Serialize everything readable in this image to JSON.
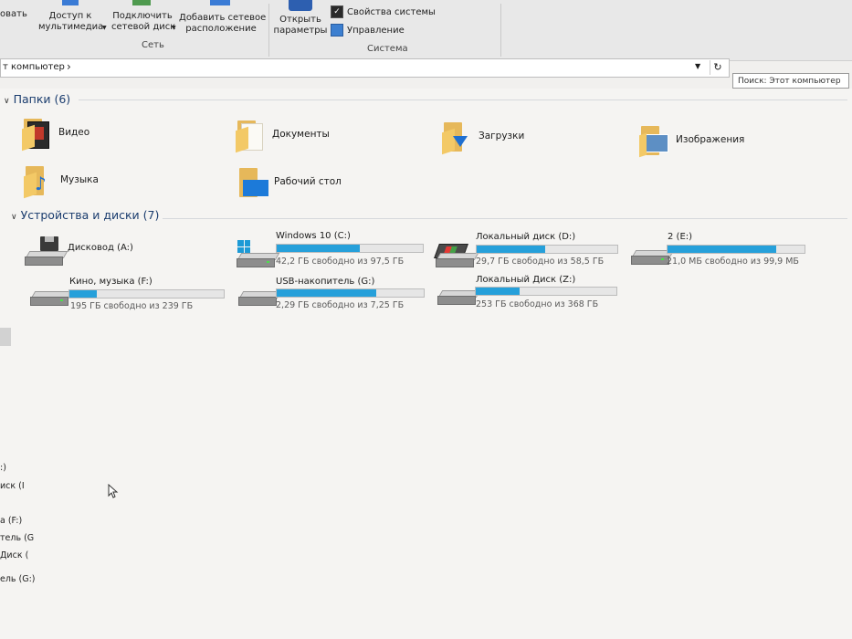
{
  "ribbon": {
    "partial_left": "овать",
    "media_access": "Доступ к\nмультимедиа",
    "map_drive": "Подключить\nсетевой диск",
    "add_location": "Добавить сетевое\nрасположение",
    "group_network": "Сеть",
    "open_settings": "Открыть\nпараметры",
    "system_properties": "Свойства системы",
    "manage": "Управление",
    "group_system": "Система"
  },
  "address": {
    "path": "т компьютер",
    "search_placeholder": "Поиск: Этот компьютер"
  },
  "folders": {
    "header": "Папки (6)",
    "items": [
      {
        "label": "Видео",
        "icon": "video-folder-icon"
      },
      {
        "label": "Документы",
        "icon": "documents-folder-icon"
      },
      {
        "label": "Загрузки",
        "icon": "downloads-folder-icon"
      },
      {
        "label": "Изображения",
        "icon": "pictures-folder-icon"
      },
      {
        "label": "Музыка",
        "icon": "music-folder-icon"
      },
      {
        "label": "Рабочий стол",
        "icon": "desktop-folder-icon"
      }
    ]
  },
  "drives": {
    "header": "Устройства и диски (7)",
    "items": [
      {
        "label": "Дисковод (A:)",
        "free": "",
        "used_fraction": null
      },
      {
        "label": "Windows 10 (C:)",
        "free": "42,2 ГБ свободно из 97,5 ГБ",
        "used_fraction": 0.57
      },
      {
        "label": "Локальный диск (D:)",
        "free": "29,7 ГБ свободно из 58,5 ГБ",
        "used_fraction": 0.49
      },
      {
        "label": "2 (E:)",
        "free": "21,0 МБ свободно из 99,9 МБ",
        "used_fraction": 0.79
      },
      {
        "label": "Кино, музыка (F:)",
        "free": "195 ГБ свободно из 239 ГБ",
        "used_fraction": 0.18
      },
      {
        "label": "USB-накопитель (G:)",
        "free": "2,29 ГБ свободно из 7,25 ГБ",
        "used_fraction": 0.68
      },
      {
        "label": "Локальный Диск (Z:)",
        "free": "253 ГБ свободно из 368 ГБ",
        "used_fraction": 0.31
      }
    ]
  },
  "nav_fragments": [
    ":)",
    "иск (I",
    "а (F:)",
    "тель (G",
    "Диск (",
    "ель (G:)"
  ],
  "colors": {
    "accent": "#26a0da",
    "folder": "#f3c966"
  }
}
